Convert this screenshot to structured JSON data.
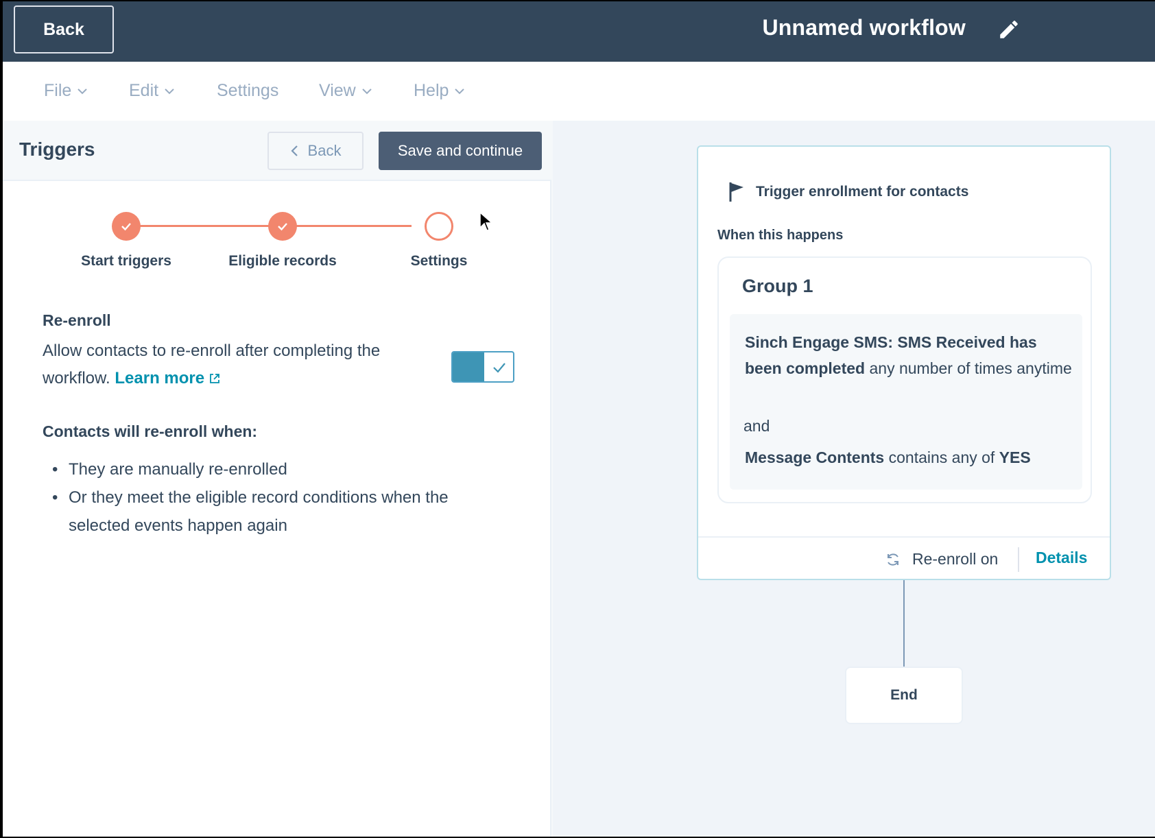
{
  "header": {
    "back_label": "Back",
    "workflow_title": "Unnamed workflow"
  },
  "menu": [
    {
      "label": "File",
      "has_dropdown": true
    },
    {
      "label": "Edit",
      "has_dropdown": true
    },
    {
      "label": "Settings",
      "has_dropdown": false
    },
    {
      "label": "View",
      "has_dropdown": true
    },
    {
      "label": "Help",
      "has_dropdown": true
    }
  ],
  "panel": {
    "title": "Triggers",
    "back_label": "Back",
    "save_label": "Save and continue",
    "steps": [
      {
        "label": "Start triggers",
        "status": "done"
      },
      {
        "label": "Eligible records",
        "status": "done"
      },
      {
        "label": "Settings",
        "status": "current"
      }
    ],
    "reenroll": {
      "title": "Re-enroll",
      "description": "Allow contacts to re-enroll after completing the workflow.",
      "learn_more": "Learn more",
      "enabled": true
    },
    "conditions_title": "Contacts will re-enroll when:",
    "conditions": [
      "They are manually re-enrolled",
      "Or they meet the eligible record conditions when the selected events happen again"
    ]
  },
  "trigger_card": {
    "title": "Trigger enrollment for contacts",
    "when": "When this happens",
    "group_title": "Group 1",
    "condition1_bold": "Sinch Engage SMS: SMS Received has been completed",
    "condition1_rest": " any number of times anytime",
    "and": "and",
    "condition2_field": "Message Contents",
    "condition2_op": " contains any of ",
    "condition2_value": "YES",
    "reenroll_status": "Re-enroll on",
    "details_label": "Details"
  },
  "end_node": {
    "label": "End"
  },
  "colors": {
    "topbar": "#33475b",
    "accent_orange": "#f2866d",
    "link_teal": "#0091ae",
    "toggle_on": "#3e95b5"
  }
}
